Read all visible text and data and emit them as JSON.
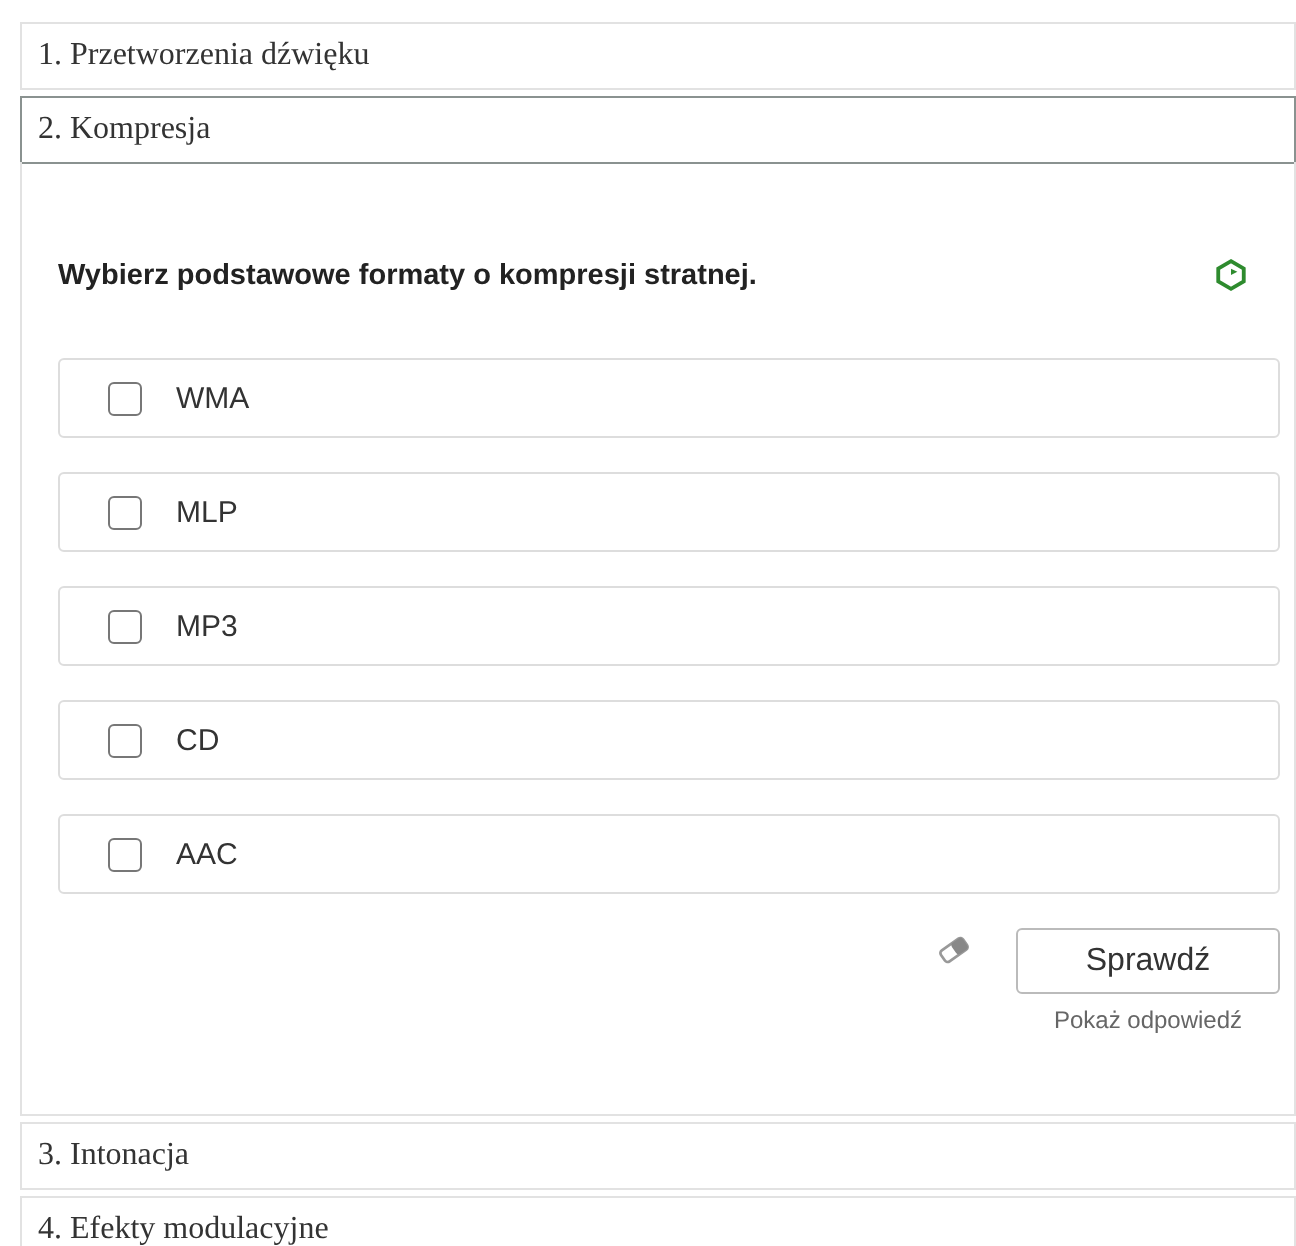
{
  "sections": [
    {
      "title": "1. Przetworzenia dźwięku",
      "expanded": false
    },
    {
      "title": "2. Kompresja",
      "expanded": true,
      "question": "Wybierz podstawowe formaty o kompresji stratnej.",
      "options": [
        {
          "label": "WMA",
          "checked": false
        },
        {
          "label": "MLP",
          "checked": false
        },
        {
          "label": "MP3",
          "checked": false
        },
        {
          "label": "CD",
          "checked": false
        },
        {
          "label": "AAC",
          "checked": false
        }
      ],
      "check_button": "Sprawdź",
      "show_answer": "Pokaż odpowiedź"
    },
    {
      "title": "3. Intonacja",
      "expanded": false
    },
    {
      "title": "4. Efekty modulacyjne",
      "expanded": false
    }
  ]
}
